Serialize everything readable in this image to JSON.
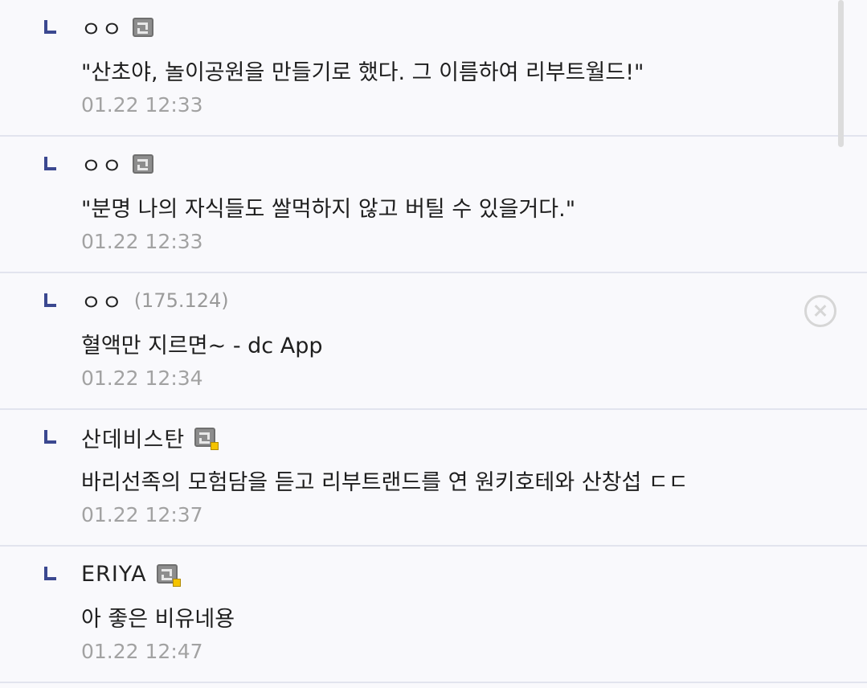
{
  "comments": [
    {
      "nickname": "ㅇㅇ",
      "ip": "",
      "content": "\"산초야, 놀이공원을 만들기로 했다. 그 이름하여 리부트월드!\"",
      "date": "01.22 12:33",
      "icon": "gallog-icon"
    },
    {
      "nickname": "ㅇㅇ",
      "ip": "",
      "content": "\"분명 나의 자식들도 쌀먹하지 않고 버틸 수 있을거다.\"",
      "date": "01.22 12:33",
      "icon": "gallog-icon"
    },
    {
      "nickname": "ㅇㅇ",
      "ip": "(175.124)",
      "content": "혈액만 지르면~ - dc App",
      "date": "01.22 12:34",
      "icon": "delete-icon"
    },
    {
      "nickname": "산데비스탄",
      "ip": "",
      "content": "바리선족의 모험담을 듣고 리부트랜드를 연 원키호테와 산창섭 ㄷㄷ",
      "date": "01.22 12:37",
      "icon": "semi-gallog-icon"
    },
    {
      "nickname": "ERIYA",
      "ip": "",
      "content": "아 좋은 비유네용",
      "date": "01.22 12:47",
      "icon": "semi-gallog-icon"
    }
  ],
  "colors": {
    "background": "#f9f9fc",
    "reply_arrow": "#3b4890",
    "date_text": "#a2a2a2",
    "separator": "#e2e4ee"
  }
}
